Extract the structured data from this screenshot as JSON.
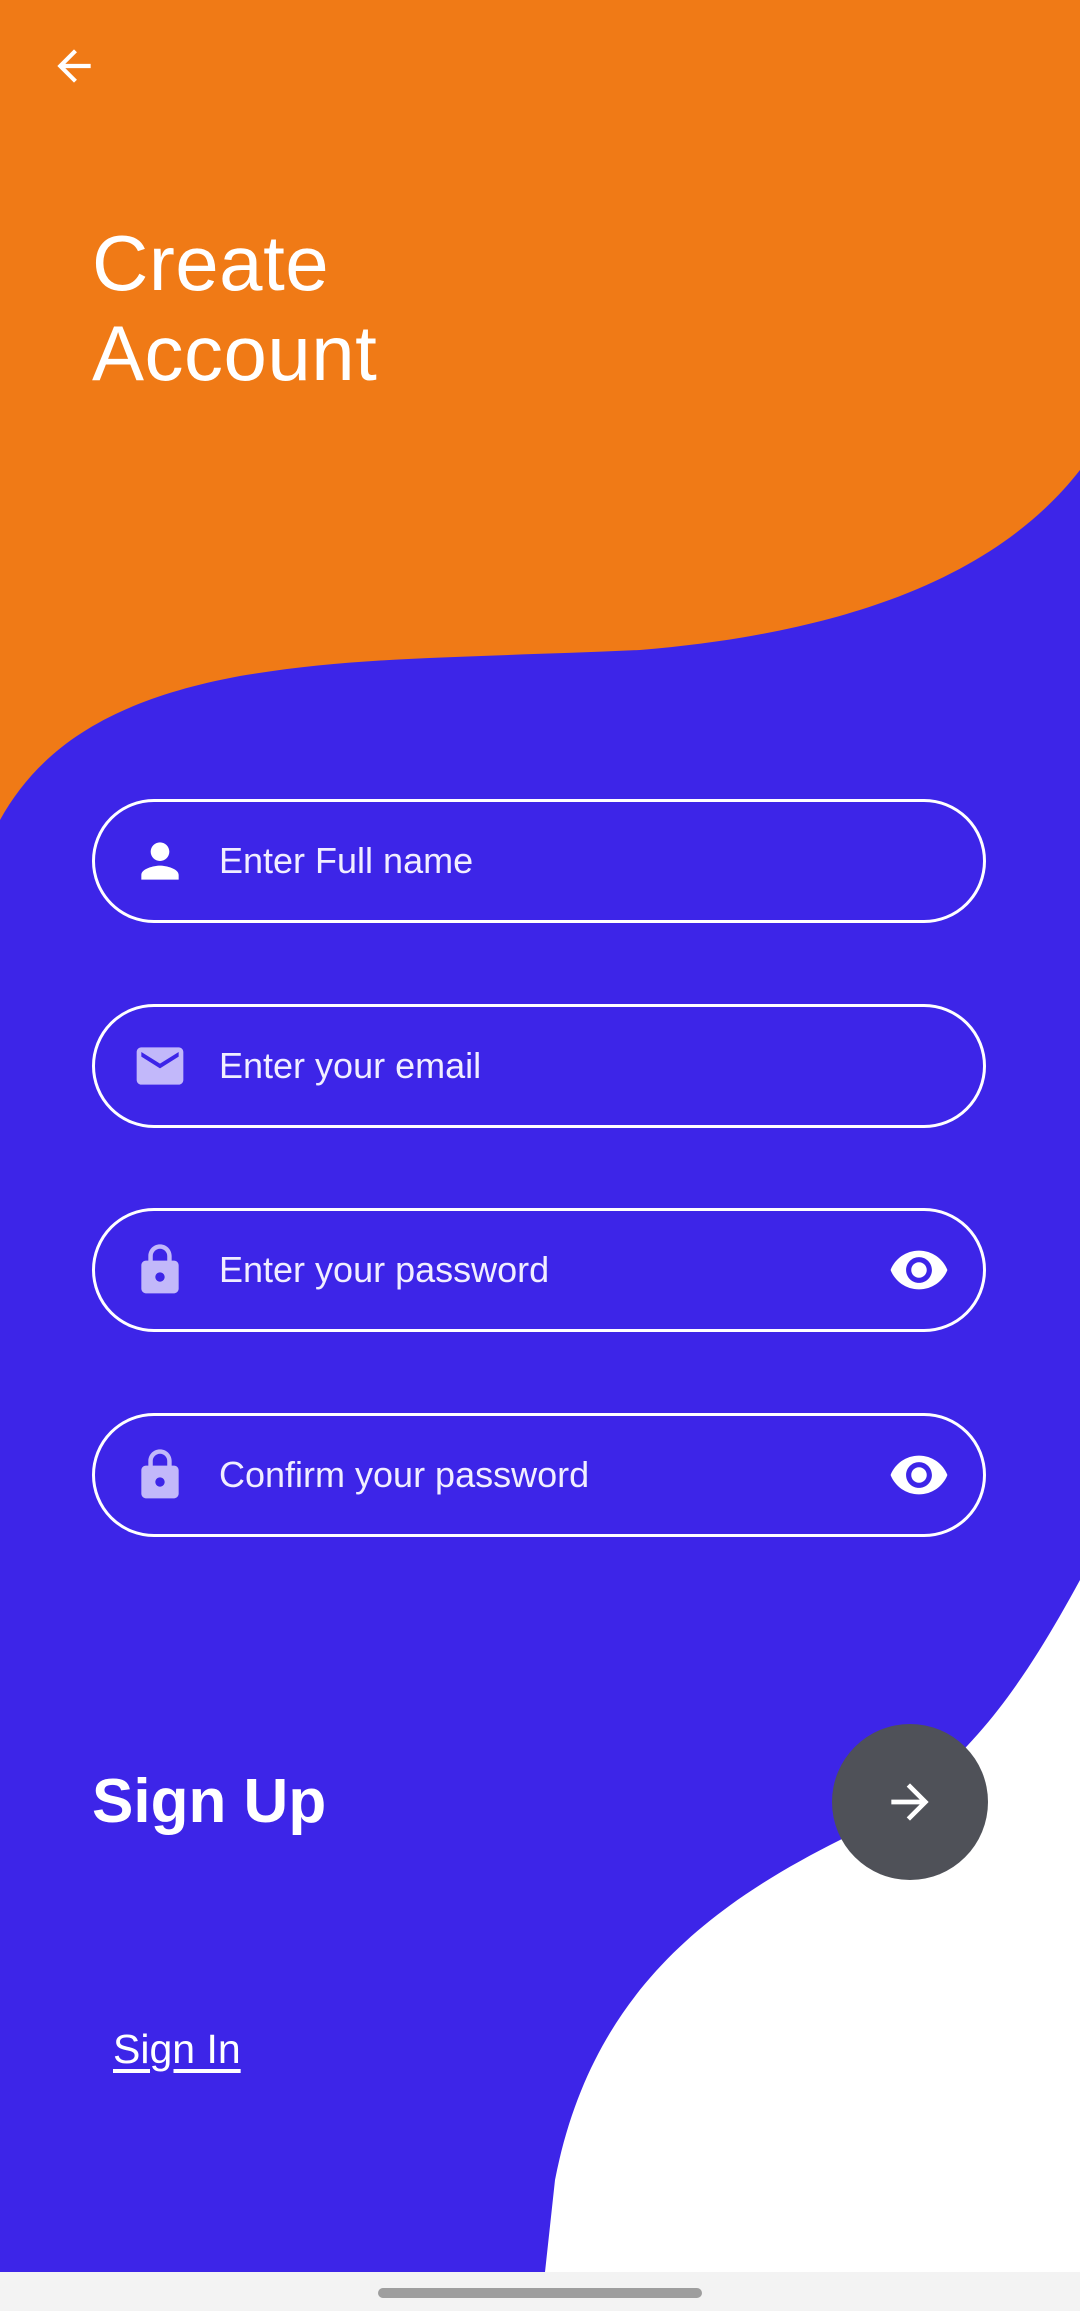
{
  "header": {
    "back_icon": "arrow-back-icon",
    "title_line1": "Create",
    "title_line2": "Account"
  },
  "form": {
    "full_name": {
      "placeholder": "Enter Full name",
      "value": "",
      "icon": "person-icon"
    },
    "email": {
      "placeholder": "Enter your email",
      "value": "",
      "icon": "envelope-icon"
    },
    "password": {
      "placeholder": "Enter your password",
      "value": "",
      "icon": "lock-icon",
      "toggle_icon": "eye-icon"
    },
    "confirm_password": {
      "placeholder": "Confirm your password",
      "value": "",
      "icon": "lock-icon",
      "toggle_icon": "eye-icon"
    }
  },
  "actions": {
    "signup_label": "Sign Up",
    "signup_button_icon": "arrow-forward-icon",
    "signin_link": "Sign In"
  },
  "colors": {
    "orange": "#f07a16",
    "purple": "#3d25e8",
    "button_gray": "#4f5158",
    "white": "#ffffff",
    "icon_lavender": "#c2b8fa"
  }
}
